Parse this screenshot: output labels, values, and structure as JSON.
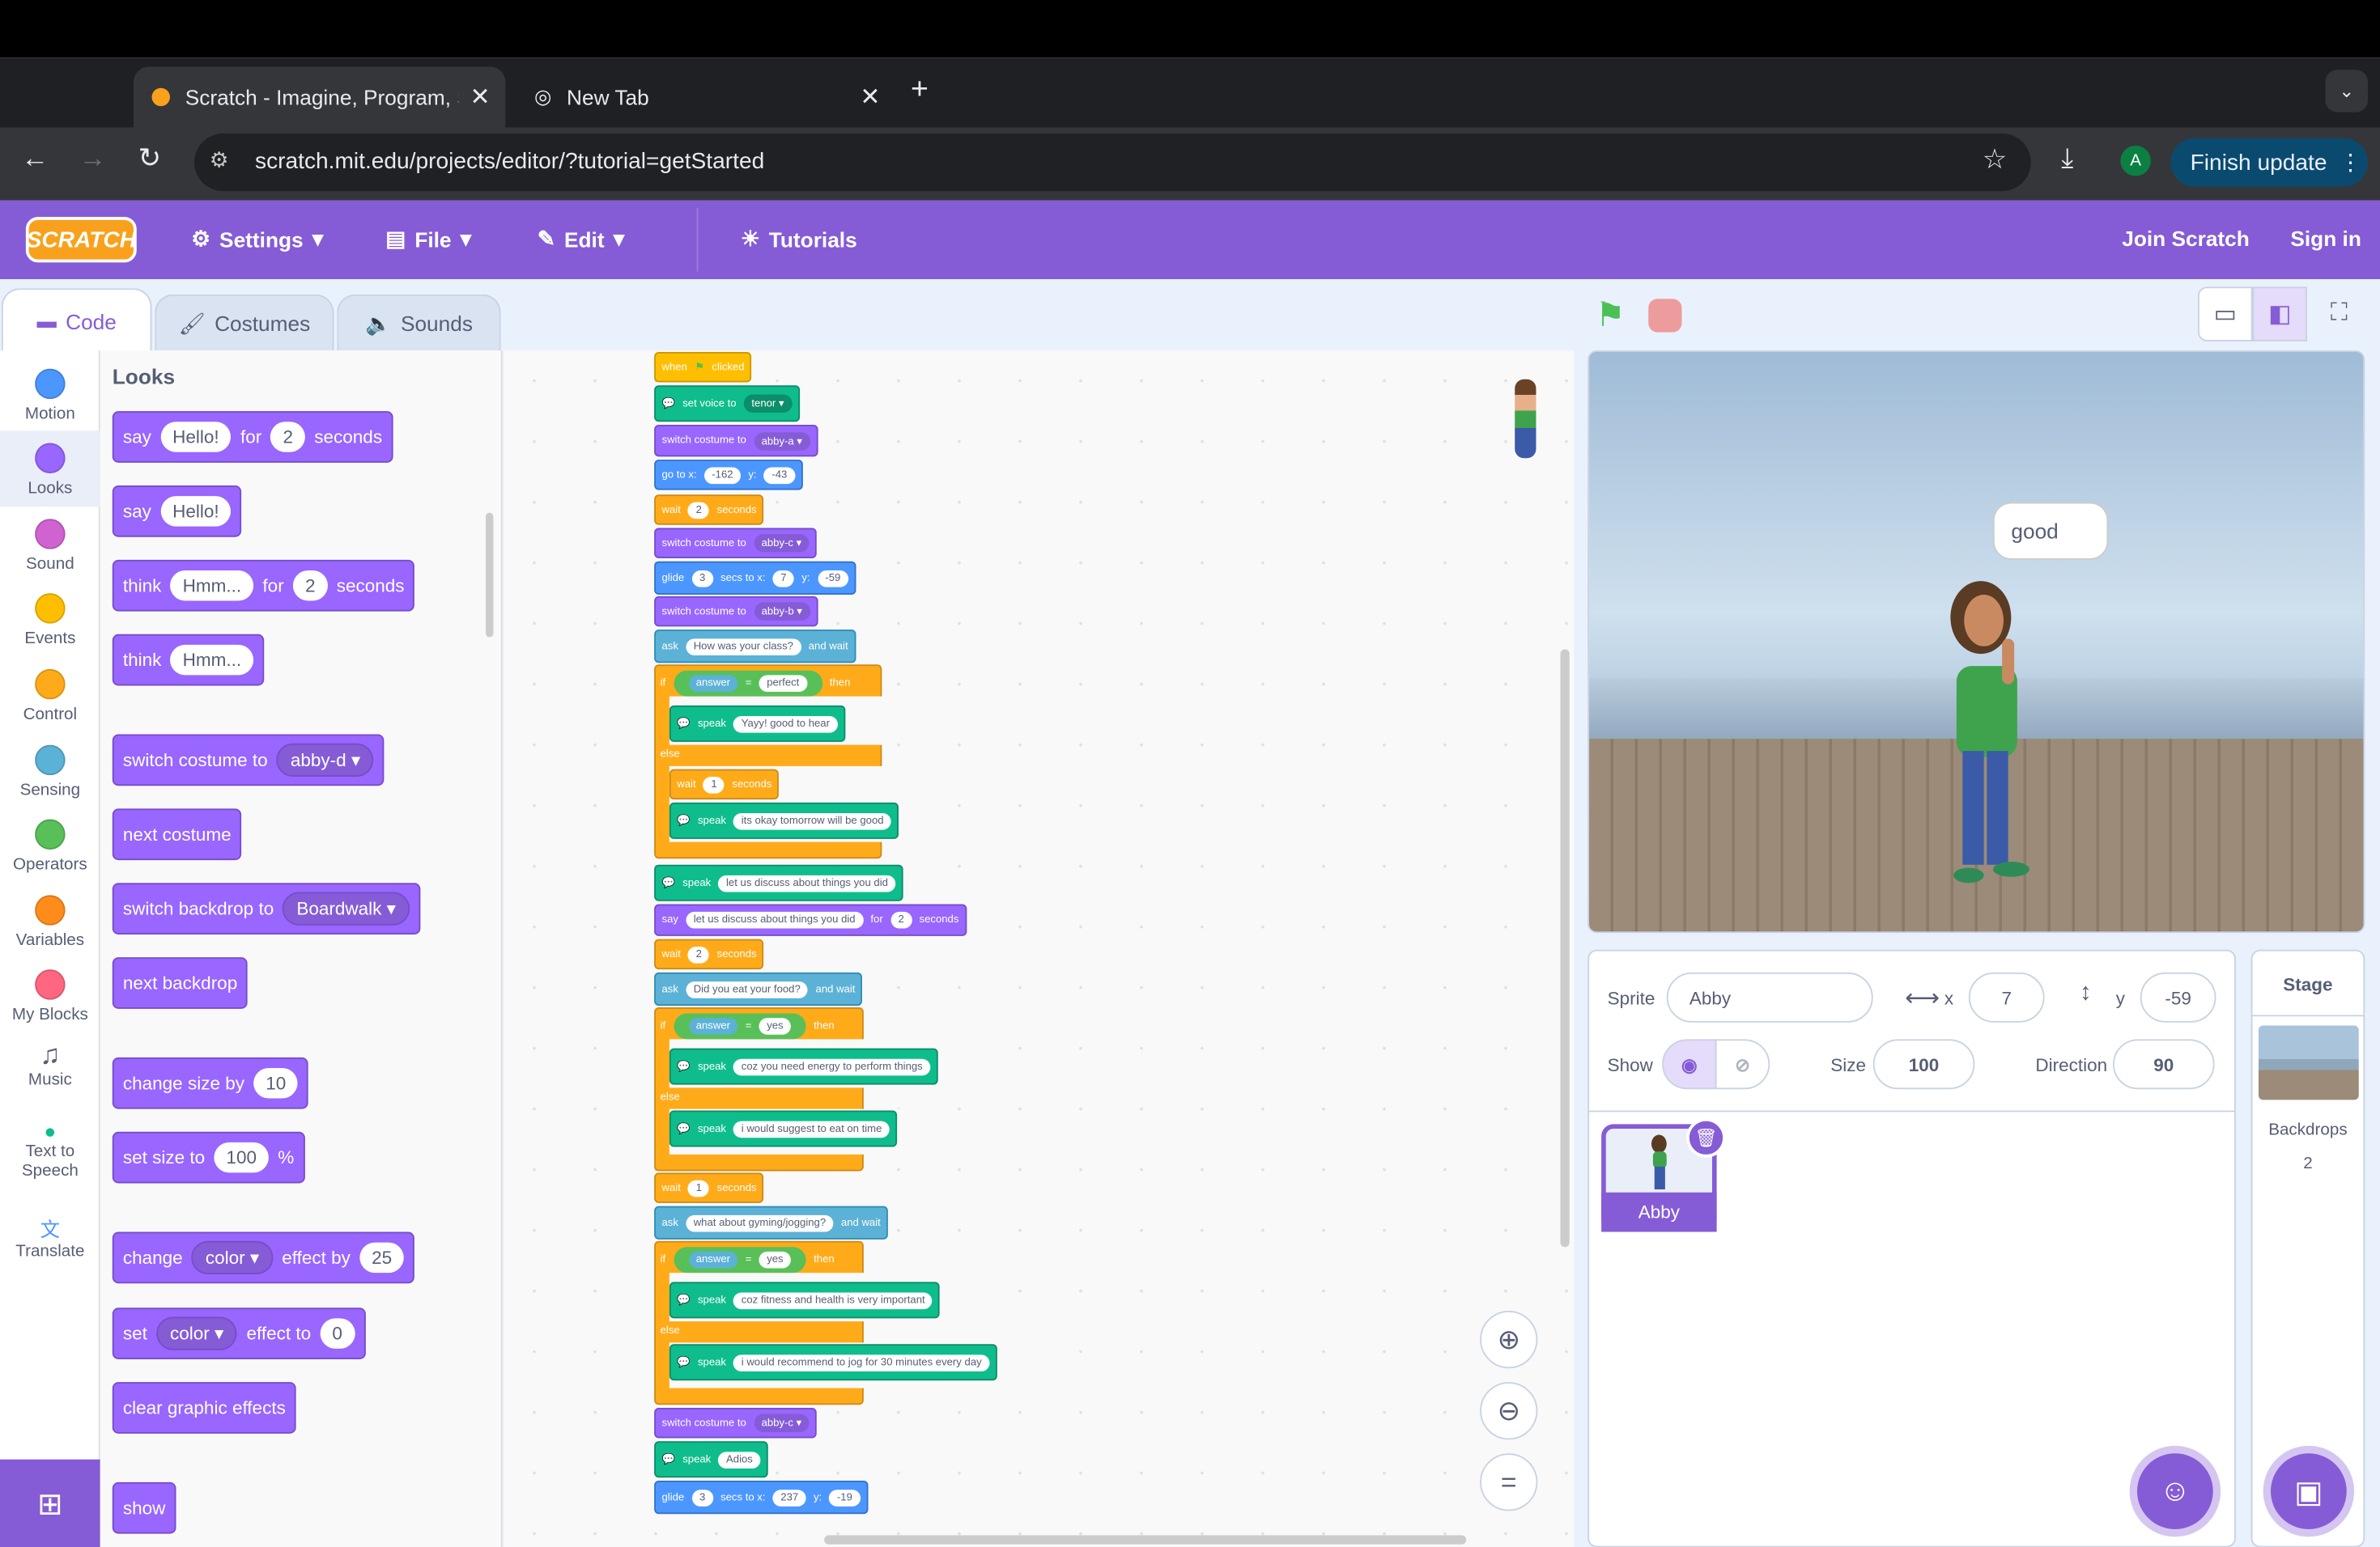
{
  "browser": {
    "tabs": [
      {
        "title": "Scratch - Imagine, Program, S"
      },
      {
        "title": "New Tab"
      }
    ],
    "url": "scratch.mit.edu/projects/editor/?tutorial=getStarted",
    "account_initial": "A",
    "finish_update": "Finish update"
  },
  "menubar": {
    "logo": "SCRATCH",
    "settings": "Settings",
    "file": "File",
    "edit": "Edit",
    "tutorials": "Tutorials",
    "join": "Join Scratch",
    "signin": "Sign in"
  },
  "editor_tabs": {
    "code": "Code",
    "costumes": "Costumes",
    "sounds": "Sounds"
  },
  "categories": [
    {
      "label": "Motion",
      "color": "#4c97ff"
    },
    {
      "label": "Looks",
      "color": "#9966ff"
    },
    {
      "label": "Sound",
      "color": "#cf63cf"
    },
    {
      "label": "Events",
      "color": "#ffbf00"
    },
    {
      "label": "Control",
      "color": "#ffab19"
    },
    {
      "label": "Sensing",
      "color": "#5cb1d6"
    },
    {
      "label": "Operators",
      "color": "#59c059"
    },
    {
      "label": "Variables",
      "color": "#ff8c1a"
    },
    {
      "label": "My Blocks",
      "color": "#ff6680"
    },
    {
      "label": "Music"
    },
    {
      "label": "Text to Speech"
    },
    {
      "label": "Translate"
    }
  ],
  "palette": {
    "heading": "Looks",
    "b1": {
      "a": "say",
      "v": "Hello!",
      "b": "for",
      "n": "2",
      "c": "seconds"
    },
    "b2": {
      "a": "say",
      "v": "Hello!"
    },
    "b3": {
      "a": "think",
      "v": "Hmm...",
      "b": "for",
      "n": "2",
      "c": "seconds"
    },
    "b4": {
      "a": "think",
      "v": "Hmm..."
    },
    "b5": {
      "a": "switch costume to",
      "d": "abby-d"
    },
    "b6": {
      "a": "next costume"
    },
    "b7": {
      "a": "switch backdrop to",
      "d": "Boardwalk"
    },
    "b8": {
      "a": "next backdrop"
    },
    "b9": {
      "a": "change size by",
      "n": "10"
    },
    "b10": {
      "a": "set size to",
      "n": "100",
      "c": "%"
    },
    "b11": {
      "a": "change",
      "d": "color",
      "b": "effect by",
      "n": "25"
    },
    "b12": {
      "a": "set",
      "d": "color",
      "b": "effect to",
      "n": "0"
    },
    "b13": {
      "a": "clear graphic effects"
    },
    "b14": {
      "a": "show"
    }
  },
  "script": {
    "s1": [
      "when",
      "clicked"
    ],
    "s2": [
      "set voice to",
      "tenor"
    ],
    "s3": [
      "switch costume to",
      "abby-a"
    ],
    "s4": [
      "go to x:",
      "-162",
      "y:",
      "-43"
    ],
    "s5": [
      "wait",
      "2",
      "seconds"
    ],
    "s6": [
      "switch costume to",
      "abby-c"
    ],
    "s7": [
      "glide",
      "3",
      "secs to x:",
      "7",
      "y:",
      "-59"
    ],
    "s8": [
      "switch costume to",
      "abby-b"
    ],
    "s9": [
      "ask",
      "How was your class?",
      "and wait"
    ],
    "s10": [
      "if",
      "answer",
      "=",
      "perfect",
      "then"
    ],
    "s11": [
      "speak",
      "Yayy! good to hear"
    ],
    "s12": [
      "else"
    ],
    "s13": [
      "wait",
      "1",
      "seconds"
    ],
    "s14": [
      "speak",
      "its okay tomorrow will be good"
    ],
    "s15": [
      "speak",
      "let us discuss about things you did"
    ],
    "s16": [
      "say",
      "let us discuss about things you did",
      "for",
      "2",
      "seconds"
    ],
    "s17": [
      "wait",
      "2",
      "seconds"
    ],
    "s18": [
      "ask",
      "Did you eat your food?",
      "and wait"
    ],
    "s19": [
      "if",
      "answer",
      "=",
      "yes",
      "then"
    ],
    "s20": [
      "speak",
      "coz you need energy to perform things"
    ],
    "s21": [
      "else"
    ],
    "s22": [
      "speak",
      "i would suggest to eat on time"
    ],
    "s23": [
      "wait",
      "1",
      "seconds"
    ],
    "s24": [
      "ask",
      "what about gyming/jogging?",
      "and wait"
    ],
    "s25": [
      "if",
      "answer",
      "=",
      "yes",
      "then"
    ],
    "s26": [
      "speak",
      "coz fitness and health is very important"
    ],
    "s27": [
      "else"
    ],
    "s28": [
      "speak",
      "i would recommend to jog for 30 minutes every day"
    ],
    "s29": [
      "switch costume to",
      "abby-c"
    ],
    "s30": [
      "speak",
      "Adios"
    ],
    "s31": [
      "glide",
      "3",
      "secs to x:",
      "237",
      "y:",
      "-19"
    ]
  },
  "stage": {
    "bubble": "good"
  },
  "sprite_info": {
    "sprite_label": "Sprite",
    "sprite_name": "Abby",
    "x_label": "x",
    "x": "7",
    "y_label": "y",
    "y": "-59",
    "show_label": "Show",
    "size_label": "Size",
    "size": "100",
    "direction_label": "Direction",
    "direction": "90"
  },
  "sprite_list": [
    {
      "name": "Abby"
    }
  ],
  "stage_panel": {
    "title": "Stage",
    "backdrops_label": "Backdrops",
    "backdrops_count": "2"
  }
}
